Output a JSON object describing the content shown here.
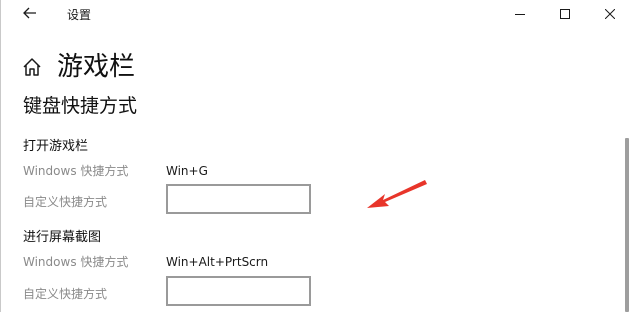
{
  "window": {
    "title": "设置",
    "icons": {
      "back": "back-arrow-icon",
      "minimize": "minimize-icon",
      "maximize": "maximize-icon",
      "close": "close-icon",
      "home": "home-icon"
    }
  },
  "page": {
    "title": "游戏栏",
    "section_title": "键盘快捷方式"
  },
  "groups": [
    {
      "title": "打开游戏栏",
      "windows_shortcut_label": "Windows 快捷方式",
      "windows_shortcut_value": "Win+G",
      "custom_shortcut_label": "自定义快捷方式",
      "custom_shortcut_value": ""
    },
    {
      "title": "进行屏幕截图",
      "windows_shortcut_label": "Windows 快捷方式",
      "windows_shortcut_value": "Win+Alt+PrtScrn",
      "custom_shortcut_label": "自定义快捷方式",
      "custom_shortcut_value": ""
    }
  ],
  "annotation": {
    "arrow_color": "#e8352a"
  }
}
